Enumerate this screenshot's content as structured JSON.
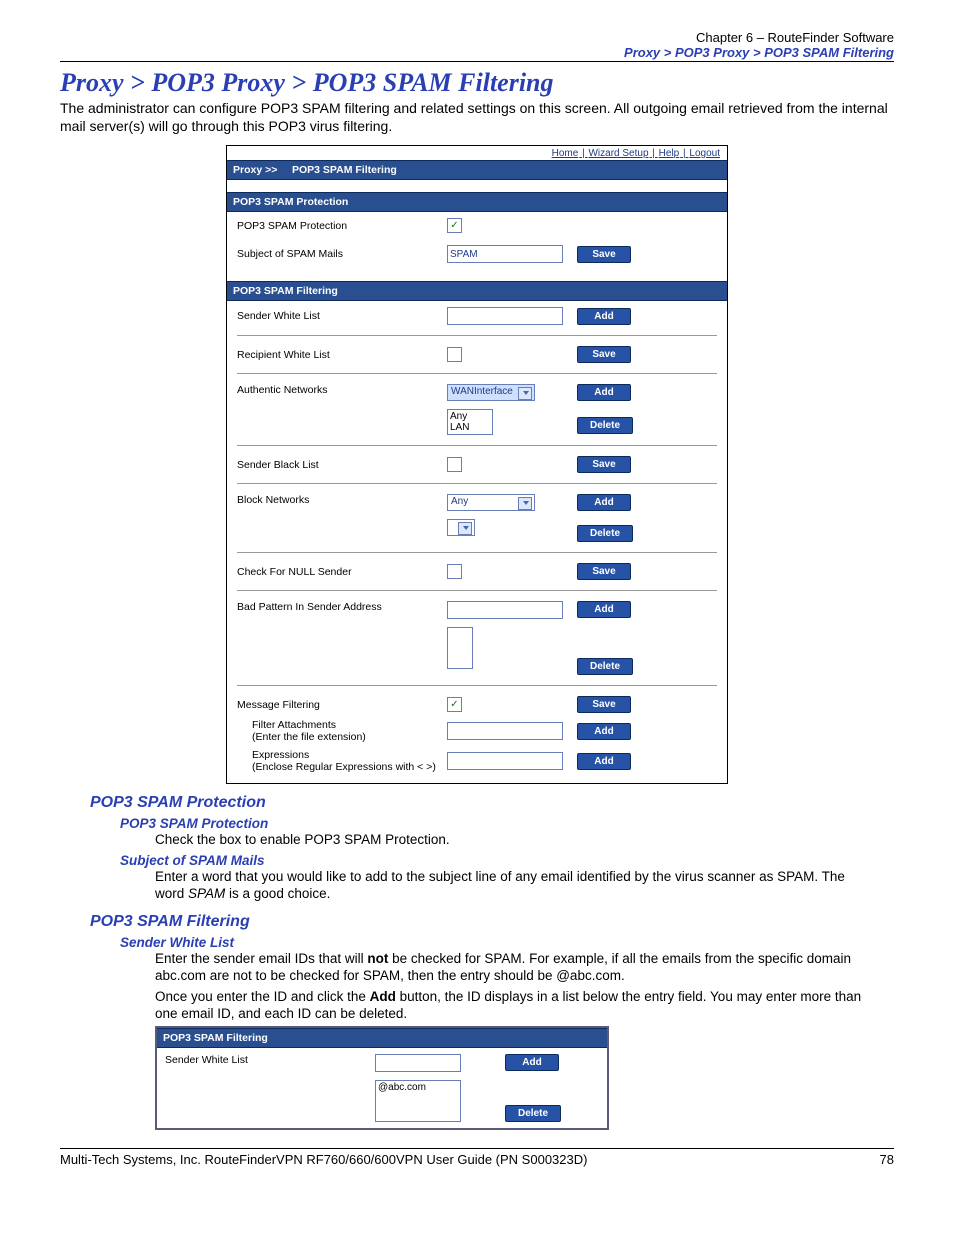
{
  "header": {
    "chapter": "Chapter 6 – RouteFinder Software",
    "crumb": "Proxy > POP3 Proxy > POP3 SPAM Filtering"
  },
  "title": "Proxy > POP3 Proxy > POP3 SPAM Filtering",
  "intro": "The administrator can configure POP3 SPAM filtering and related settings on this screen. All outgoing email retrieved from the internal mail server(s) will go through this POP3 virus filtering.",
  "ui": {
    "nav": {
      "home": "Home",
      "wizard": "Wizard Setup",
      "help": "Help",
      "logout": "Logout"
    },
    "crumb_prefix": "Proxy >>",
    "crumb_page": "POP3 SPAM Filtering",
    "section_protection": "POP3 SPAM Protection",
    "section_filtering": "POP3 SPAM Filtering",
    "labels": {
      "spam_protection": "POP3 SPAM Protection",
      "spam_subject": "Subject of SPAM Mails",
      "sender_white": "Sender White List",
      "recipient_white": "Recipient White List",
      "auth_networks": "Authentic Networks",
      "sender_black": "Sender Black List",
      "block_networks": "Block Networks",
      "null_sender": "Check For NULL Sender",
      "bad_pattern": "Bad Pattern In Sender Address",
      "msg_filtering": "Message Filtering",
      "filter_attach": "Filter Attachments\n(Enter the file extension)",
      "expressions": "Expressions\n(Enclose Regular Expressions with < >)"
    },
    "values": {
      "spam_subject": "SPAM",
      "auth_select": "WANInterface",
      "auth_list_line1": "Any",
      "auth_list_line2": "LAN",
      "block_select": "Any"
    },
    "buttons": {
      "save": "Save",
      "add": "Add",
      "delete": "Delete"
    }
  },
  "desc": {
    "h_protection": "POP3 SPAM Protection",
    "h_protection_sub": "POP3 SPAM Protection",
    "protection_text": "Check the box to enable POP3 SPAM Protection.",
    "h_subject": "Subject of SPAM Mails",
    "subject_text_1": "Enter a word that you would like to add to the subject line of any email identified by the virus scanner as SPAM. The word ",
    "subject_text_italic": "SPAM",
    "subject_text_2": " is a good choice.",
    "h_filtering": "POP3 SPAM Filtering",
    "h_senderwhite": "Sender White List",
    "senderwhite_p1a": "Enter the sender email IDs that will ",
    "senderwhite_p1_bold": "not",
    "senderwhite_p1b": " be checked for SPAM. For example, if all the emails from the specific domain abc.com are not to be checked for SPAM, then the entry should be @abc.com.",
    "senderwhite_p2a": "Once you enter the ID and click the ",
    "senderwhite_p2_bold": "Add",
    "senderwhite_p2b": " button, the ID displays in a list below the entry field. You may enter more than one email ID, and each ID can be deleted."
  },
  "ui2": {
    "heading": "POP3 SPAM Filtering",
    "label": "Sender White List",
    "list_value": "@abc.com",
    "add": "Add",
    "delete": "Delete"
  },
  "footer": {
    "left": "Multi-Tech Systems, Inc. RouteFinderVPN RF760/660/600VPN User Guide (PN S000323D)",
    "right": "78"
  }
}
